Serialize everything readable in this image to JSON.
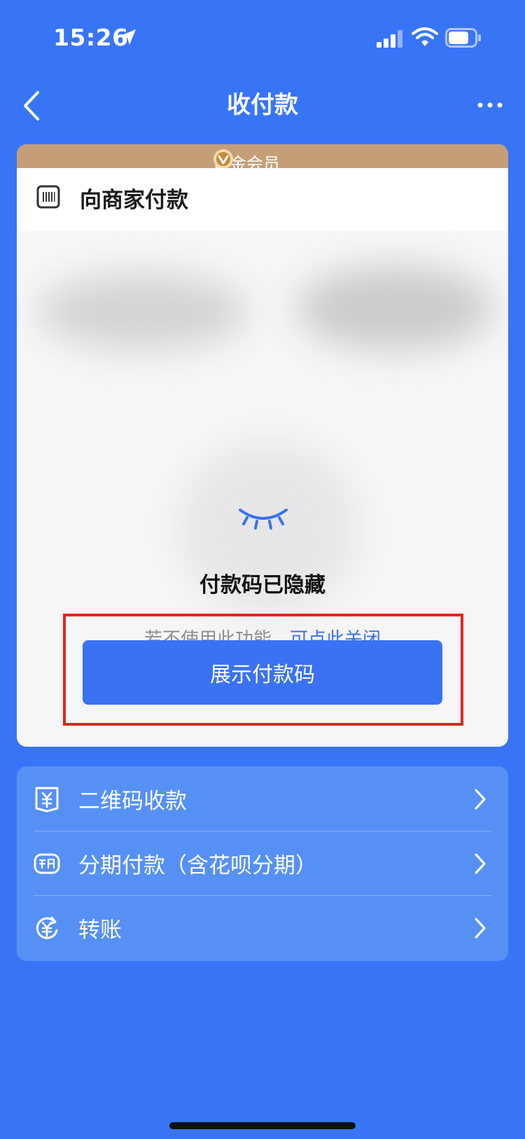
{
  "status_bar": {
    "time": "15:26"
  },
  "nav": {
    "title": "收付款"
  },
  "card": {
    "member_label": "黄金会员",
    "title": "向商家付款",
    "hidden_title": "付款码已隐藏",
    "hint_text": "若不使用此功能，",
    "hint_link": "可点此关闭",
    "show_button": "展示付款码"
  },
  "services": {
    "items": [
      {
        "label": "二维码收款",
        "icon": "qr-receive-icon"
      },
      {
        "label": "分期付款（含花呗分期）",
        "icon": "installment-icon"
      },
      {
        "label": "转账",
        "icon": "transfer-icon"
      }
    ]
  },
  "colors": {
    "background": "#3874f6",
    "member_banner": "#c59e78",
    "button": "#3a72f4",
    "link": "#3a72e8",
    "highlight": "#e8231e",
    "service_panel": "#5690f4"
  }
}
